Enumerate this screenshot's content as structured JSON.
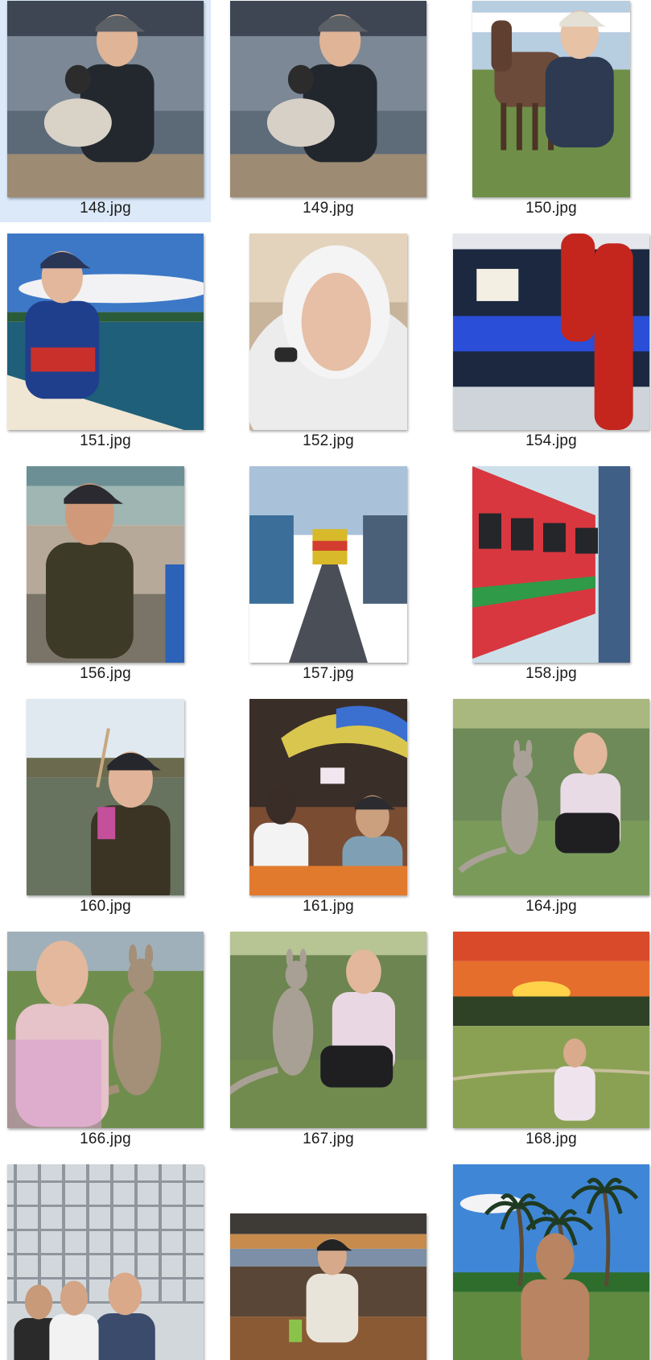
{
  "files": [
    {
      "name": "148.jpg",
      "selected": true,
      "shape": "big",
      "scene": "barn-lamb",
      "colors": {
        "bg": "#5c6a78",
        "mid": "#23282f",
        "fg": "#d9d2c7"
      }
    },
    {
      "name": "149.jpg",
      "selected": false,
      "shape": "big",
      "scene": "barn-lamb",
      "colors": {
        "bg": "#5e6b79",
        "mid": "#22272e",
        "fg": "#d7d0c6"
      }
    },
    {
      "name": "150.jpg",
      "selected": false,
      "shape": "port",
      "scene": "horse-field",
      "colors": {
        "bg": "#b7cde0",
        "mid": "#2d3a52",
        "fg": "#6f8f48"
      }
    },
    {
      "name": "151.jpg",
      "selected": false,
      "shape": "big",
      "scene": "boat-sea",
      "colors": {
        "bg": "#3d78c7",
        "mid": "#1f3f8c",
        "fg": "#c9302c"
      }
    },
    {
      "name": "152.jpg",
      "selected": false,
      "shape": "port",
      "scene": "hoodie-selfie",
      "colors": {
        "bg": "#c8b49a",
        "mid": "#ececec",
        "fg": "#2a2a2a"
      }
    },
    {
      "name": "154.jpg",
      "selected": false,
      "shape": "big",
      "scene": "indoor-skydive",
      "colors": {
        "bg": "#1b2840",
        "mid": "#2a4ed8",
        "fg": "#c4261e"
      }
    },
    {
      "name": "156.jpg",
      "selected": false,
      "shape": "port",
      "scene": "market-selfie",
      "colors": {
        "bg": "#9fb6b2",
        "mid": "#3d3a28",
        "fg": "#d09a7a"
      }
    },
    {
      "name": "157.jpg",
      "selected": false,
      "shape": "port",
      "scene": "train-market",
      "colors": {
        "bg": "#a9c2da",
        "mid": "#4a4f57",
        "fg": "#d8b92a"
      }
    },
    {
      "name": "158.jpg",
      "selected": false,
      "shape": "port",
      "scene": "red-train",
      "colors": {
        "bg": "#cde0ea",
        "mid": "#d8373f",
        "fg": "#2f9a48"
      }
    },
    {
      "name": "160.jpg",
      "selected": false,
      "shape": "port",
      "scene": "canal-selfie",
      "colors": {
        "bg": "#dfe9ef",
        "mid": "#5f6b58",
        "fg": "#3b3424"
      }
    },
    {
      "name": "161.jpg",
      "selected": false,
      "shape": "port",
      "scene": "floating-market",
      "colors": {
        "bg": "#3a2e28",
        "mid": "#d9c64e",
        "fg": "#e27a2d"
      }
    },
    {
      "name": "164.jpg",
      "selected": false,
      "shape": "big",
      "scene": "kangaroo-crouch",
      "colors": {
        "bg": "#6e8a58",
        "mid": "#a9a197",
        "fg": "#1f1f22"
      }
    },
    {
      "name": "166.jpg",
      "selected": false,
      "shape": "big",
      "scene": "kangaroo-selfie",
      "colors": {
        "bg": "#6f8e4e",
        "mid": "#e5c3c9",
        "fg": "#a48f78"
      }
    },
    {
      "name": "167.jpg",
      "selected": false,
      "shape": "big",
      "scene": "kangaroo-pet",
      "colors": {
        "bg": "#6d8551",
        "mid": "#a8a094",
        "fg": "#1f1f22"
      }
    },
    {
      "name": "168.jpg",
      "selected": false,
      "shape": "big",
      "scene": "sunset-field",
      "colors": {
        "bg": "#e56e2c",
        "mid": "#2f4226",
        "fg": "#8aa154"
      }
    },
    {
      "name": "",
      "selected": false,
      "shape": "big",
      "scene": "scaffold-crowd",
      "colors": {
        "bg": "#d2d7db",
        "mid": "#8f969d",
        "fg": "#3b4b6c"
      }
    },
    {
      "name": "",
      "selected": false,
      "shape": "land",
      "scene": "bar-sunset",
      "colors": {
        "bg": "#c68b4d",
        "mid": "#e9e4da",
        "fg": "#8a5a34"
      }
    },
    {
      "name": "",
      "selected": false,
      "shape": "big",
      "scene": "palm-beach",
      "colors": {
        "bg": "#3f87d6",
        "mid": "#1f3a22",
        "fg": "#b88462"
      }
    }
  ]
}
